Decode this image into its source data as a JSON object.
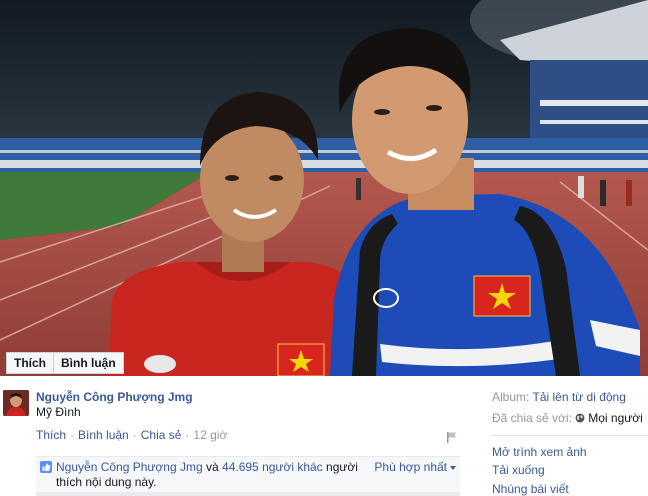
{
  "photo_actions": {
    "like_label": "Thích",
    "comment_label": "Bình luận"
  },
  "post": {
    "author": "Nguyễn Công Phượng Jmg",
    "location": "Mỹ Đình",
    "actions": {
      "like": "Thích",
      "comment": "Bình luận",
      "share": "Chia sẻ",
      "time": "12 giờ"
    },
    "likes": {
      "name": "Nguyễn Công Phượng Jmg",
      "conj": "và",
      "others": "44.695 người khác",
      "suffix": "người thích nội dung này."
    },
    "sort_label": "Phù hợp nhất"
  },
  "sidebar": {
    "album_label": "Album:",
    "album_value": "Tải lên từ di động",
    "shared_label": "Đã chia sẻ với:",
    "shared_value": "Mọi người",
    "links": {
      "open_viewer": "Mở trình xem ảnh",
      "download": "Tải xuống",
      "embed": "Nhúng bài viết"
    }
  },
  "colors": {
    "link": "#3b5998",
    "muted": "#9197a3",
    "jersey_red": "#c8261e",
    "jersey_blue": "#1d4bb8"
  }
}
